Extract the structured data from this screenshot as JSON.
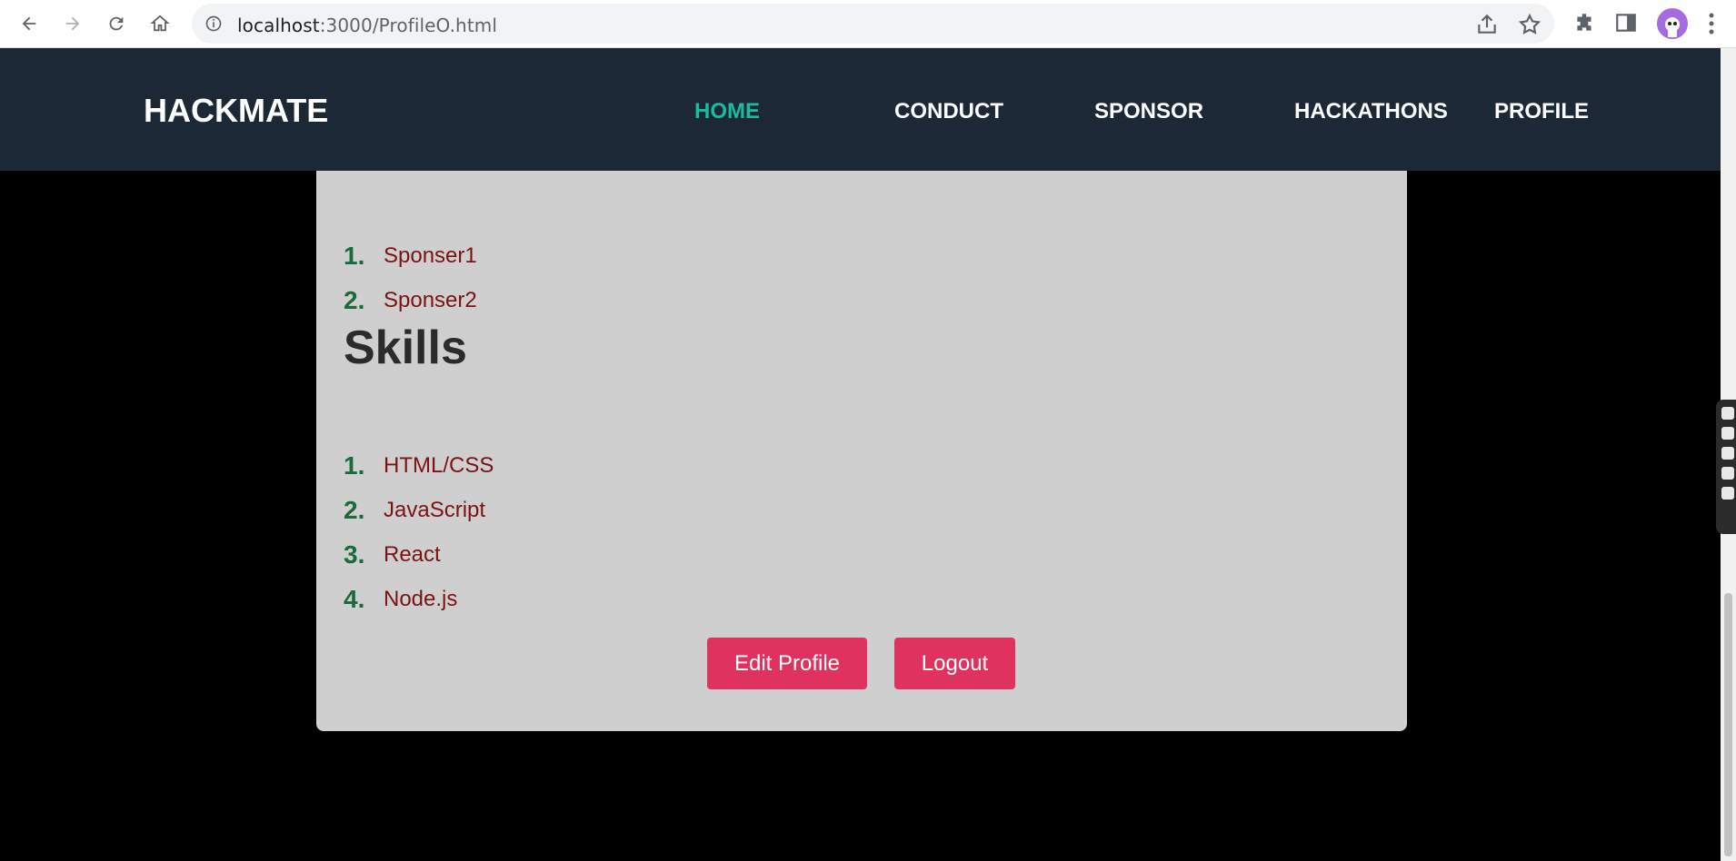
{
  "browser": {
    "url_host": "localhost",
    "url_rest": ":3000/ProfileO.html",
    "icons": [
      "back-icon",
      "forward-icon",
      "reload-icon",
      "home-icon",
      "info-icon",
      "share-icon",
      "star-icon",
      "extensions-icon",
      "side-panel-icon",
      "profile-avatar",
      "menu-icon"
    ]
  },
  "header": {
    "brand": "HACKMATE",
    "nav": [
      "HOME",
      "CONDUCT",
      "SPONSOR",
      "HACKATHONS",
      "PROFILE"
    ],
    "active": "HOME",
    "colors": {
      "background": "#1c2836",
      "active": "#1abc9c"
    }
  },
  "profile": {
    "sponsors": [
      {
        "num": "1.",
        "label": "Sponser1"
      },
      {
        "num": "2.",
        "label": "Sponser2"
      }
    ],
    "skills_title": "Skills",
    "skills": [
      {
        "num": "1.",
        "label": "HTML/CSS"
      },
      {
        "num": "2.",
        "label": "JavaScript"
      },
      {
        "num": "3.",
        "label": "React"
      },
      {
        "num": "4.",
        "label": "Node.js"
      }
    ],
    "buttons": {
      "edit": "Edit Profile",
      "logout": "Logout"
    },
    "colors": {
      "button": "#e0325f",
      "number": "#1b6b3a",
      "item": "#7a1414",
      "card": "#cfcfcf"
    }
  }
}
